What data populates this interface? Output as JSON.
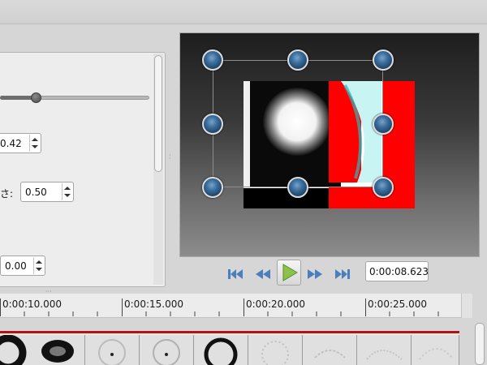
{
  "properties": {
    "spin_top_value": "0.42",
    "size_label": "さ:",
    "size_value": "0.50",
    "spin_bottom_value": "0.00",
    "slider_level": 0.24
  },
  "transport": {
    "timecode": "0:00:08.623",
    "icons": [
      "skip-to-start-icon",
      "rewind-icon",
      "play-icon",
      "fast-forward-icon",
      "skip-to-end-icon"
    ]
  },
  "timeline": {
    "ruler_labels": [
      "0:00:10.000",
      "0:00:15.000",
      "0:00:20.000",
      "0:00:25.000"
    ]
  },
  "colors": {
    "accent_red": "#ff0000",
    "handle_blue": "#3b6f9e",
    "play_green": "#8bc34a",
    "transport_blue": "#4a7fbf",
    "timeline_red": "#b21414"
  }
}
